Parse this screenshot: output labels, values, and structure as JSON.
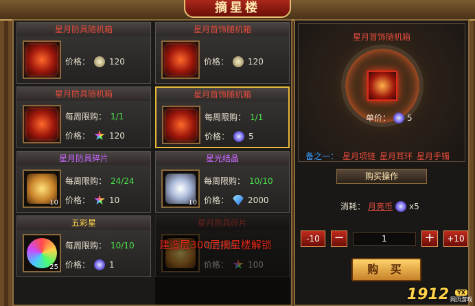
{
  "title": "摘星楼",
  "cards": [
    {
      "name": "星月防具随机箱",
      "title_color": "red",
      "glow": "red",
      "limit_label": "",
      "limit": "",
      "price_label": "价格：",
      "price": "120",
      "currency": "coin",
      "qty": ""
    },
    {
      "name": "星月首饰随机箱",
      "title_color": "red",
      "glow": "red",
      "limit_label": "",
      "limit": "",
      "price_label": "价格：",
      "price": "120",
      "currency": "coin",
      "qty": ""
    },
    {
      "name": "星月防具随机箱",
      "title_color": "red",
      "glow": "red",
      "limit_label": "每周限购：",
      "limit": "1/1",
      "price_label": "价格：",
      "price": "120",
      "currency": "star",
      "qty": ""
    },
    {
      "name": "星月首饰随机箱",
      "title_color": "red",
      "glow": "red",
      "limit_label": "每周限购：",
      "limit": "1/1",
      "price_label": "价格：",
      "price": "5",
      "currency": "moon",
      "qty": ""
    },
    {
      "name": "星月防具碎片",
      "title_color": "purple",
      "glow": "gold",
      "limit_label": "每周限购：",
      "limit": "24/24",
      "price_label": "价格：",
      "price": "10",
      "currency": "star",
      "qty": "10"
    },
    {
      "name": "星光结晶",
      "title_color": "purple",
      "glow": "silver",
      "limit_label": "每周限购：",
      "limit": "10/10",
      "price_label": "价格：",
      "price": "2000",
      "currency": "gem",
      "qty": "10"
    },
    {
      "name": "五彩星",
      "title_color": "gold",
      "glow": "rainbow",
      "limit_label": "每周限购：",
      "limit": "10/10",
      "price_label": "价格：",
      "price": "1",
      "currency": "moon",
      "qty": "25"
    },
    {
      "name": "星月防具碎片",
      "title_color": "red",
      "glow": "gold",
      "limit_label": "每周限购：",
      "limit": "",
      "price_label": "价格：",
      "price": "100",
      "currency": "star",
      "qty": ""
    }
  ],
  "lock_text": "建造层300层摘星楼解锁",
  "preview": {
    "title": "星月首饰随机箱",
    "price_label": "单价：",
    "price": "5",
    "note_label": "备之一：",
    "items": [
      "星月项链",
      "星月耳环",
      "星月手镯"
    ]
  },
  "buy": {
    "section_title": "购买操作",
    "cost_label": "消耗：",
    "currency_name": "月亮币",
    "cost_amount": "x5",
    "minus10": "-10",
    "minus": "−",
    "qty": "1",
    "plus": "+",
    "plus10": "+10",
    "buy_label": "购 买"
  },
  "watermark": {
    "num": "1912",
    "yx": "YX",
    "sub": "网页游戏"
  }
}
